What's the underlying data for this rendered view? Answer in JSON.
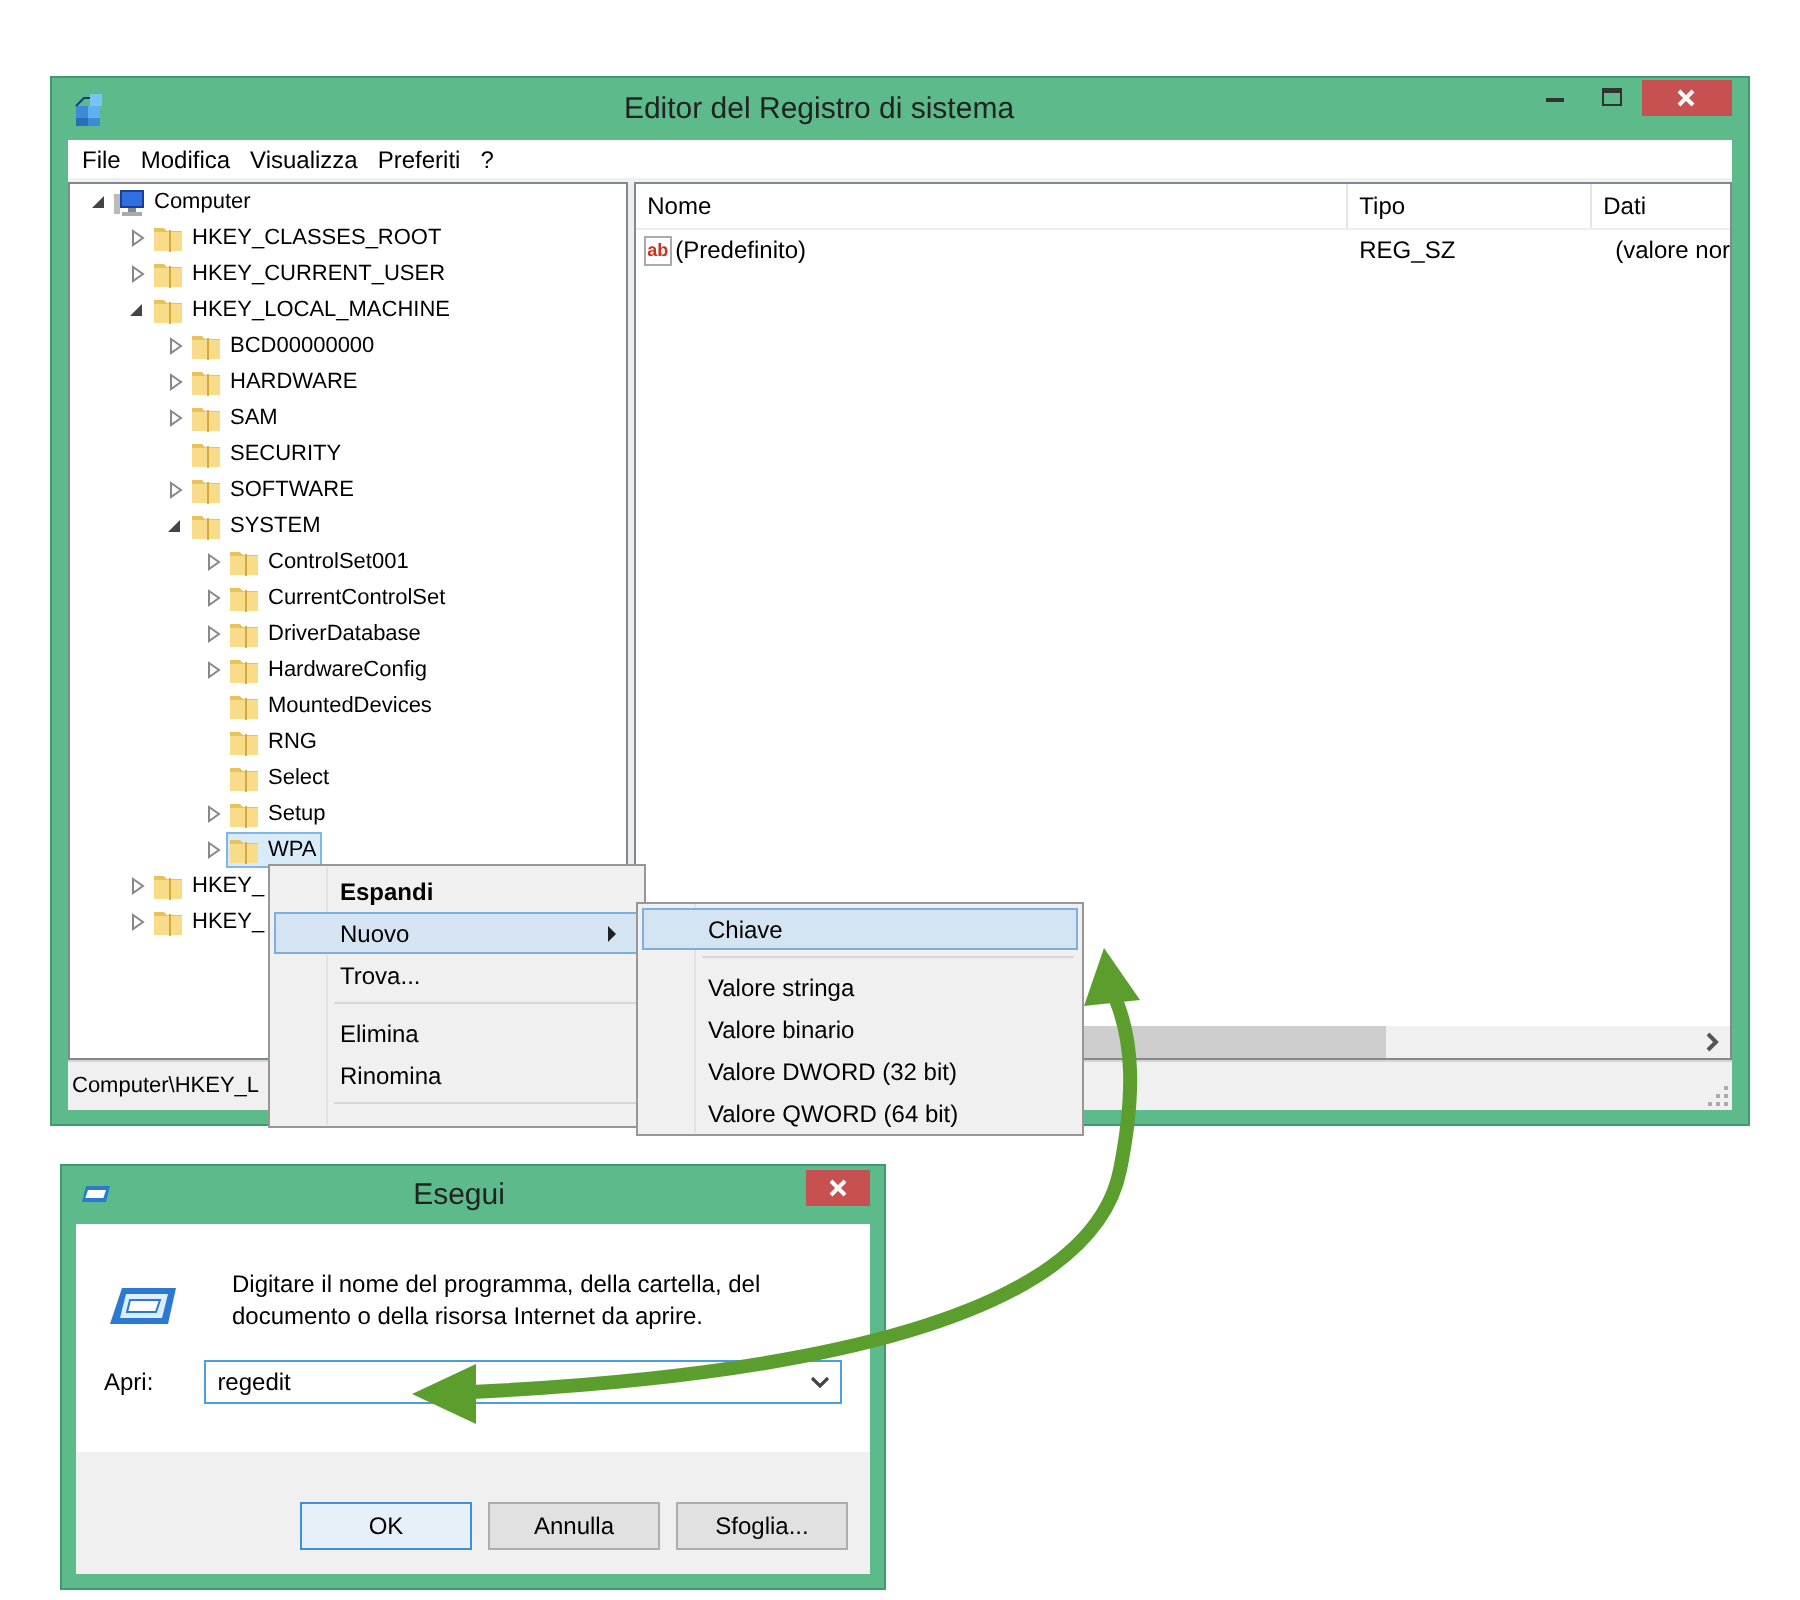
{
  "registry_window": {
    "title": "Editor del Registro di sistema",
    "menu": [
      "File",
      "Modifica",
      "Visualizza",
      "Preferiti",
      "?"
    ],
    "tree": [
      {
        "label": "Computer",
        "kind": "computer",
        "expanded": true,
        "selected": false,
        "children": [
          {
            "label": "HKEY_CLASSES_ROOT",
            "kind": "folder",
            "expanded": false,
            "selected": false
          },
          {
            "label": "HKEY_CURRENT_USER",
            "kind": "folder",
            "expanded": false,
            "selected": false
          },
          {
            "label": "HKEY_LOCAL_MACHINE",
            "kind": "folder",
            "expanded": true,
            "selected": false,
            "children": [
              {
                "label": "BCD00000000",
                "kind": "folder",
                "expanded": false,
                "selected": false
              },
              {
                "label": "HARDWARE",
                "kind": "folder",
                "expanded": false,
                "selected": false
              },
              {
                "label": "SAM",
                "kind": "folder",
                "expanded": false,
                "selected": false
              },
              {
                "label": "SECURITY",
                "kind": "folder",
                "selected": false
              },
              {
                "label": "SOFTWARE",
                "kind": "folder",
                "expanded": false,
                "selected": false
              },
              {
                "label": "SYSTEM",
                "kind": "folder",
                "expanded": true,
                "selected": false,
                "children": [
                  {
                    "label": "ControlSet001",
                    "kind": "folder",
                    "expanded": false,
                    "selected": false
                  },
                  {
                    "label": "CurrentControlSet",
                    "kind": "folder",
                    "expanded": false,
                    "selected": false
                  },
                  {
                    "label": "DriverDatabase",
                    "kind": "folder",
                    "expanded": false,
                    "selected": false
                  },
                  {
                    "label": "HardwareConfig",
                    "kind": "folder",
                    "expanded": false,
                    "selected": false
                  },
                  {
                    "label": "MountedDevices",
                    "kind": "folder",
                    "selected": false
                  },
                  {
                    "label": "RNG",
                    "kind": "folder",
                    "selected": false
                  },
                  {
                    "label": "Select",
                    "kind": "folder",
                    "selected": false
                  },
                  {
                    "label": "Setup",
                    "kind": "folder",
                    "expanded": false,
                    "selected": false
                  },
                  {
                    "label": "WPA",
                    "kind": "folder",
                    "expanded": false,
                    "selected": true
                  }
                ]
              }
            ]
          },
          {
            "label": "HKEY_",
            "kind": "folder",
            "expanded": false,
            "selected": false
          },
          {
            "label": "HKEY_",
            "kind": "folder",
            "expanded": false,
            "selected": false
          }
        ]
      }
    ],
    "list": {
      "columns": [
        "Nome",
        "Tipo",
        "Dati"
      ],
      "rows": [
        {
          "kind": "string",
          "icon_text": "ab",
          "cells": [
            "(Predefinito)",
            "REG_SZ",
            "(valore nor"
          ]
        }
      ]
    },
    "status_bar": "Computer\\HKEY_L",
    "context_menu": [
      {
        "kind": "default",
        "label": "Espandi",
        "selected": false
      },
      {
        "kind": "submenu",
        "label": "Nuovo",
        "selected": true
      },
      {
        "kind": "item",
        "label": "Trova...",
        "selected": false
      },
      {
        "kind": "separator"
      },
      {
        "kind": "item",
        "label": "Elimina",
        "selected": false
      },
      {
        "kind": "item",
        "label": "Rinomina",
        "selected": false
      },
      {
        "kind": "separator"
      }
    ],
    "submenu": [
      {
        "kind": "item",
        "label": "Chiave",
        "selected": true
      },
      {
        "kind": "separator"
      },
      {
        "kind": "item",
        "label": "Valore stringa",
        "selected": false
      },
      {
        "kind": "item",
        "label": "Valore binario",
        "selected": false
      },
      {
        "kind": "item",
        "label": "Valore DWORD (32 bit)",
        "selected": false
      },
      {
        "kind": "item",
        "label": "Valore QWORD (64 bit)",
        "selected": false
      }
    ]
  },
  "run_dialog": {
    "title": "Esegui",
    "prompt": "Digitare il nome del programma, della cartella, del documento o della risorsa Internet da aprire.",
    "open_label": "Apri:",
    "command": {
      "value": "regedit"
    },
    "buttons": [
      {
        "label": "OK",
        "default": true
      },
      {
        "label": "Annulla",
        "default": false
      },
      {
        "label": "Sfoglia...",
        "default": false
      }
    ]
  }
}
